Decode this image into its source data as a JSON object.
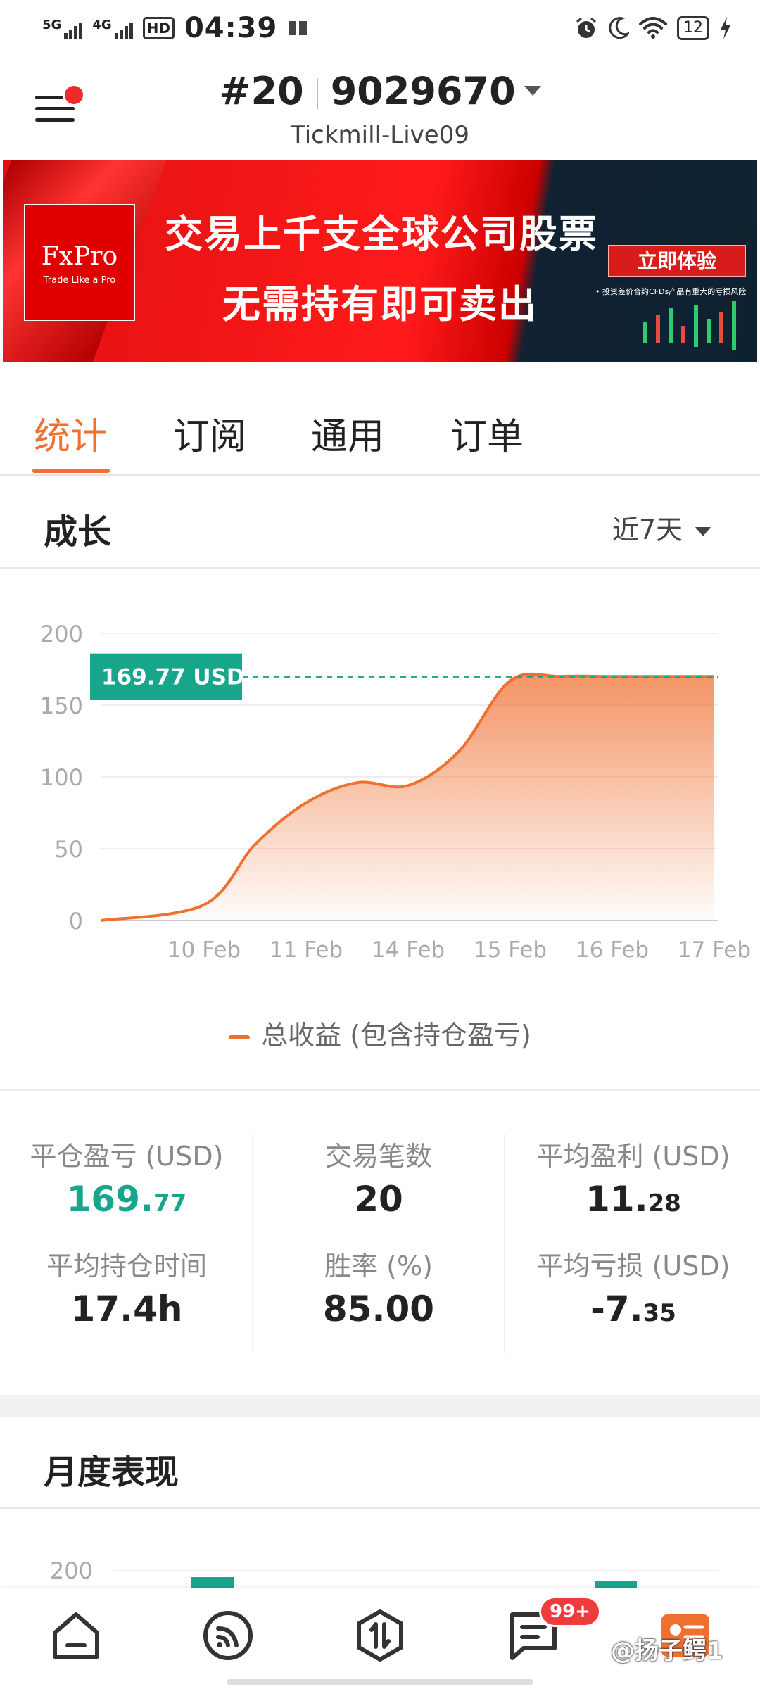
{
  "status_bar": {
    "net1": "5G",
    "net2": "4G",
    "hd": "HD",
    "time": "04:39",
    "battery": "12"
  },
  "header": {
    "account_index": "#20",
    "account_number": "9029670",
    "server": "Tickmill-Live09"
  },
  "banner": {
    "logo": "FxPro",
    "logo_tagline": "Trade Like a Pro",
    "line1": "交易上千支全球公司股票",
    "line2": "无需持有即可卖出",
    "cta": "立即体验",
    "disclaimer": "• 投资差价合约CFDs产品有重大的亏损风险"
  },
  "tabs": [
    {
      "label": "统计",
      "active": true
    },
    {
      "label": "订阅",
      "active": false
    },
    {
      "label": "通用",
      "active": false
    },
    {
      "label": "订单",
      "active": false
    }
  ],
  "growth": {
    "title": "成长",
    "period": "近7天"
  },
  "chart_data": {
    "type": "area",
    "title": "",
    "xlabel": "",
    "ylabel": "",
    "ylim": [
      0,
      200
    ],
    "y_ticks": [
      0,
      50,
      100,
      150,
      200
    ],
    "categories": [
      "10 Feb",
      "11 Feb",
      "14 Feb",
      "15 Feb",
      "16 Feb",
      "17 Feb"
    ],
    "x": [
      -0.5,
      0,
      0.5,
      1,
      1.5,
      2,
      2.5,
      3,
      3.5,
      4,
      4.5,
      5
    ],
    "series": [
      {
        "name": "总收益 (包含持仓盈亏)",
        "values": [
          0,
          11,
          53,
          82,
          96,
          94,
          118,
          167,
          170,
          170,
          170,
          170
        ],
        "color": "#f07030"
      }
    ],
    "current_value_label": "169.77 USD",
    "reference_line": 169.77,
    "reference_color": "#17a58b",
    "grid": true
  },
  "stats": {
    "closed_pl_label": "平仓盈亏 (USD)",
    "closed_pl_int": "169.",
    "closed_pl_dec": "77",
    "trades_label": "交易笔数",
    "trades_value": "20",
    "avg_profit_label": "平均盈利 (USD)",
    "avg_profit_int": "11.",
    "avg_profit_dec": "28",
    "avg_hold_label": "平均持仓时间",
    "avg_hold_value": "17.4h",
    "win_rate_label": "胜率 (%)",
    "win_rate_value": "85.00",
    "avg_loss_label": "平均亏损 (USD)",
    "avg_loss_int": "-7.",
    "avg_loss_dec": "35",
    "value_color": "#17a58b"
  },
  "monthly": {
    "title": "月度表现",
    "y_tick_top": "200"
  },
  "bottom_nav": {
    "badge": "99+",
    "watermark": "@扬子鳄1"
  }
}
